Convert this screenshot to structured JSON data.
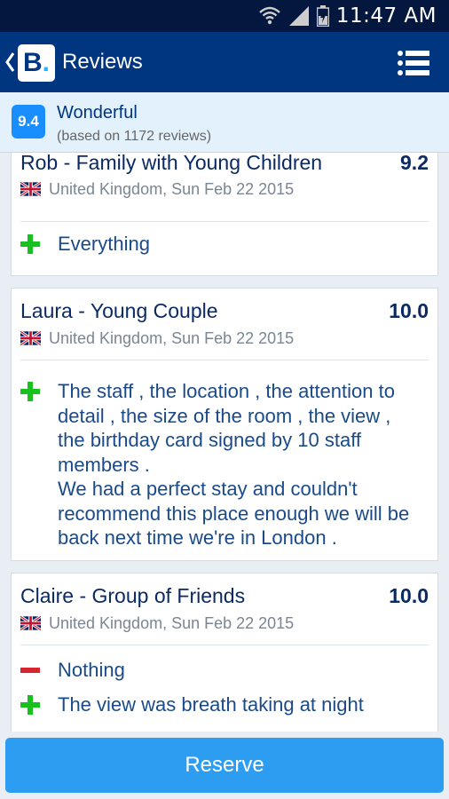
{
  "status_bar": {
    "time": "11:47 AM"
  },
  "app_bar": {
    "title": "Reviews",
    "logo_text": "B",
    "logo_dot": "."
  },
  "summary": {
    "score": "9.4",
    "label": "Wonderful",
    "count_text": "(based on 1172 reviews)"
  },
  "reviews": [
    {
      "name": "Rob - Family with Young Children",
      "score": "9.2",
      "location_date": "United Kingdom, Sun Feb 22 2015",
      "positive": "Everything"
    },
    {
      "name": "Laura - Young Couple",
      "score": "10.0",
      "location_date": "United Kingdom, Sun Feb 22 2015",
      "positive_lines": [
        "The staff , the location , the attention to",
        "detail , the size of the room , the view ,",
        "the birthday card signed by 10 staff",
        "members .",
        "We had a perfect stay and couldn't",
        "recommend this place enough we will be",
        "back next time we're in London ."
      ]
    },
    {
      "name": "Claire - Group of Friends",
      "score": "10.0",
      "location_date": "United Kingdom, Sun Feb 22 2015",
      "negative": "Nothing",
      "positive": "The view was breath taking at night"
    }
  ],
  "reserve": {
    "label": "Reserve"
  },
  "colors": {
    "brand_navy": "#003580",
    "accent_blue": "#2d9df2",
    "positive_green": "#19c11f",
    "negative_red": "#d8242f"
  }
}
